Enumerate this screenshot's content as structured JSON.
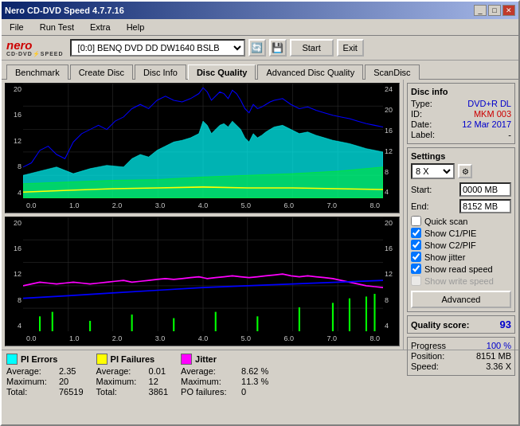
{
  "window": {
    "title": "Nero CD-DVD Speed 4.7.7.16",
    "title_buttons": [
      "_",
      "□",
      "✕"
    ]
  },
  "menu": {
    "items": [
      "File",
      "Run Test",
      "Extra",
      "Help"
    ]
  },
  "toolbar": {
    "drive_label": "[0:0]  BENQ DVD DD DW1640 BSLB",
    "start_label": "Start",
    "exit_label": "Exit"
  },
  "tabs": [
    {
      "label": "Benchmark",
      "active": false
    },
    {
      "label": "Create Disc",
      "active": false
    },
    {
      "label": "Disc Info",
      "active": false
    },
    {
      "label": "Disc Quality",
      "active": true
    },
    {
      "label": "Advanced Disc Quality",
      "active": false
    },
    {
      "label": "ScanDisc",
      "active": false
    }
  ],
  "disc_info": {
    "title": "Disc info",
    "type_label": "Type:",
    "type_value": "DVD+R DL",
    "id_label": "ID:",
    "id_value": "MKM 003",
    "date_label": "Date:",
    "date_value": "12 Mar 2017",
    "label_label": "Label:",
    "label_value": "-"
  },
  "settings": {
    "title": "Settings",
    "speed_value": "8 X",
    "start_label": "Start:",
    "start_value": "0000 MB",
    "end_label": "End:",
    "end_value": "8152 MB",
    "checkboxes": [
      {
        "label": "Quick scan",
        "checked": false
      },
      {
        "label": "Show C1/PIE",
        "checked": true
      },
      {
        "label": "Show C2/PIF",
        "checked": true
      },
      {
        "label": "Show jitter",
        "checked": true
      },
      {
        "label": "Show read speed",
        "checked": true
      },
      {
        "label": "Show write speed",
        "checked": false,
        "disabled": true
      }
    ],
    "advanced_label": "Advanced"
  },
  "quality_score": {
    "label": "Quality score:",
    "value": "93"
  },
  "progress": {
    "progress_label": "Progress",
    "progress_value": "100 %",
    "position_label": "Position:",
    "position_value": "8151 MB",
    "speed_label": "Speed:",
    "speed_value": "3.36 X"
  },
  "chart1": {
    "y_left": [
      "20",
      "16",
      "12",
      "8",
      "4"
    ],
    "y_right": [
      "24",
      "20",
      "16",
      "12",
      "8",
      "4"
    ],
    "x_axis": [
      "0.0",
      "1.0",
      "2.0",
      "3.0",
      "4.0",
      "5.0",
      "6.0",
      "7.0",
      "8.0"
    ]
  },
  "chart2": {
    "y_left": [
      "20",
      "16",
      "12",
      "8",
      "4"
    ],
    "y_right": [
      "20",
      "16",
      "12",
      "8",
      "4"
    ],
    "x_axis": [
      "0.0",
      "1.0",
      "2.0",
      "3.0",
      "4.0",
      "5.0",
      "6.0",
      "7.0",
      "8.0"
    ]
  },
  "legend": {
    "pi_errors": {
      "label": "PI Errors",
      "color": "#00ffff",
      "average_label": "Average:",
      "average_value": "2.35",
      "maximum_label": "Maximum:",
      "maximum_value": "20",
      "total_label": "Total:",
      "total_value": "76519"
    },
    "pi_failures": {
      "label": "PI Failures",
      "color": "#ffff00",
      "average_label": "Average:",
      "average_value": "0.01",
      "maximum_label": "Maximum:",
      "maximum_value": "12",
      "total_label": "Total:",
      "total_value": "3861"
    },
    "jitter": {
      "label": "Jitter",
      "color": "#ff00ff",
      "average_label": "Average:",
      "average_value": "8.62 %",
      "maximum_label": "Maximum:",
      "maximum_value": "11.3 %",
      "po_label": "PO failures:",
      "po_value": "0"
    }
  }
}
